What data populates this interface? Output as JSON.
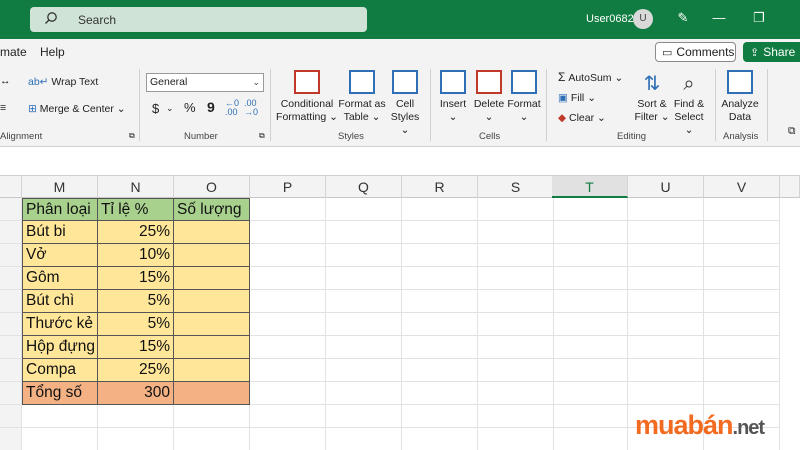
{
  "titlebar": {
    "search_placeholder": "Search",
    "user": "User0682",
    "avatar_initial": "U"
  },
  "menu": {
    "items": [
      "mate",
      "Help"
    ]
  },
  "actions": {
    "comments": "Comments",
    "share": "Share"
  },
  "ribbon": {
    "alignment": {
      "wrap_text": "Wrap Text",
      "merge_center": "Merge & Center",
      "group": "Alignment"
    },
    "number": {
      "format_value": "General",
      "dollar": "$",
      "percent": "%",
      "comma": "9",
      "group": "Number"
    },
    "styles": {
      "conditional_line1": "Conditional",
      "conditional_line2": "Formatting",
      "table_line1": "Format as",
      "table_line2": "Table",
      "cell_line1": "Cell",
      "cell_line2": "Styles",
      "group": "Styles"
    },
    "cells": {
      "insert": "Insert",
      "delete": "Delete",
      "format": "Format",
      "group": "Cells"
    },
    "editing": {
      "autosum": "AutoSum",
      "fill": "Fill",
      "clear": "Clear",
      "sort_line1": "Sort &",
      "sort_line2": "Filter",
      "find_line1": "Find &",
      "find_line2": "Select",
      "group": "Editing"
    },
    "analysis": {
      "line1": "Analyze",
      "line2": "Data",
      "group": "Analysis"
    }
  },
  "grid": {
    "columns": [
      "M",
      "N",
      "O",
      "P",
      "Q",
      "R",
      "S",
      "T",
      "U",
      "V"
    ],
    "selected_column": "T",
    "header_row": [
      "Phân loại",
      "Tỉ lệ %",
      "Số lượng"
    ],
    "rows": [
      [
        "Bút bi",
        "25%",
        ""
      ],
      [
        "Vở",
        "10%",
        ""
      ],
      [
        "Gôm",
        "15%",
        ""
      ],
      [
        "Bút chì",
        "5%",
        ""
      ],
      [
        "Thước kẻ",
        "5%",
        ""
      ],
      [
        "Hộp đựng",
        "15%",
        ""
      ],
      [
        "Compa",
        "25%",
        ""
      ]
    ],
    "total_row": [
      "Tổng số",
      "300",
      ""
    ],
    "colors": {
      "header": "#a9d18e",
      "body": "#ffe699",
      "total": "#f4b183"
    }
  },
  "watermark": {
    "brand": "muabán",
    "tld": ".net"
  }
}
